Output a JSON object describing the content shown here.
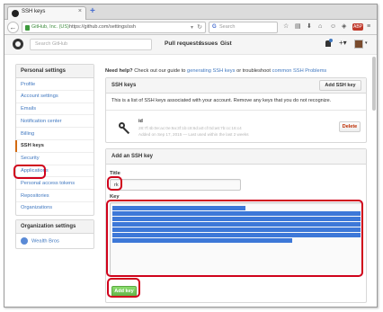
{
  "browser": {
    "tab_title": "SSH keys",
    "tab_close": "×",
    "new_tab": "+",
    "back_icon": "back-arrow-icon",
    "secure_label": "GitHub, Inc. (US)",
    "url": "https://github.com/settings/ssh",
    "url_dropdown": "▾",
    "reload": "↻",
    "search_engine": "G",
    "search_placeholder": "Search",
    "toolbar_icons": [
      "star-icon",
      "reading-list-icon",
      "download-icon",
      "home-icon",
      "chat-icon",
      "extension-icon",
      "adblock-icon",
      "menu-icon"
    ],
    "toolbar_glyphs": [
      "☆",
      "▤",
      "⬇",
      "⌂",
      "☺",
      "◈",
      "ABP",
      "≡"
    ]
  },
  "gh_header": {
    "search_placeholder": "Search GitHub",
    "nav": [
      "Pull requests",
      "Issues",
      "Gist"
    ],
    "plus": "+▾",
    "avatar_caret": "▾"
  },
  "sidebar": {
    "personal_title": "Personal settings",
    "items": [
      "Profile",
      "Account settings",
      "Emails",
      "Notification center",
      "Billing",
      "SSH keys",
      "Security",
      "Applications",
      "Personal access tokens",
      "Repositories",
      "Organizations"
    ],
    "selected_index": 5,
    "org_title": "Organization settings",
    "orgs": [
      "Wealth Bros"
    ]
  },
  "help": {
    "prefix": "Need help?",
    "middle": " Check out our guide to ",
    "link1": "generating SSH keys",
    "or": " or troubleshoot ",
    "link2": "common SSH Problems"
  },
  "ssh_keys": {
    "title": "SSH keys",
    "add_button": "Add SSH key",
    "description": "This is a list of SSH keys associated with your account. Remove any keys that you do not recognize.",
    "key": {
      "name": "id",
      "fingerprint": "28:7f:4b:0e:ac:0e:9a:3f:1b:c8:6d:a0:cf:0d:a6:7b:cc:16:c4",
      "added": "Added on Sep 17, 2015 — Last used within the last 2 weeks"
    },
    "delete_button": "Delete"
  },
  "add_form": {
    "title": "Add an SSH key",
    "title_label": "Title",
    "title_value": "rk",
    "key_label": "Key",
    "submit": "Add key"
  },
  "colors": {
    "link": "#4078c0",
    "annotation_ring": "#d0021b",
    "primary_button": "#60b044",
    "danger": "#bd2c00",
    "selection": "#3d78d8"
  }
}
